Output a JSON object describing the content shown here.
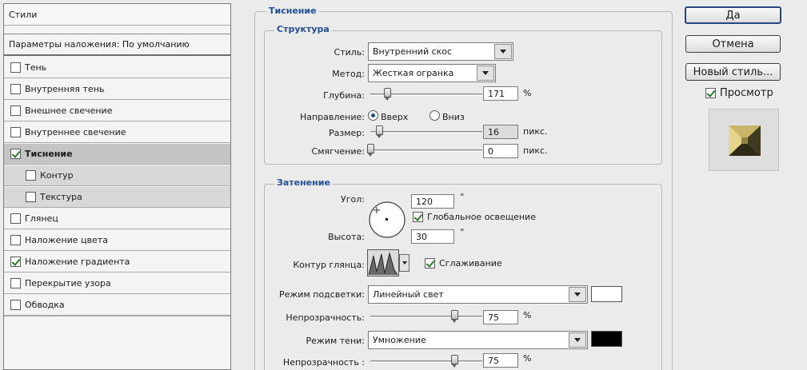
{
  "styles_panel": {
    "header": "Стили",
    "blending_options": "Параметры наложения: По умолчанию",
    "items": [
      {
        "label": "Тень",
        "checked": false
      },
      {
        "label": "Внутренняя тень",
        "checked": false
      },
      {
        "label": "Внешнее свечение",
        "checked": false
      },
      {
        "label": "Внутреннее свечение",
        "checked": false
      },
      {
        "label": "Тиснение",
        "checked": true
      },
      {
        "label": "Контур",
        "checked": false
      },
      {
        "label": "Текстура",
        "checked": false
      },
      {
        "label": "Глянец",
        "checked": false
      },
      {
        "label": "Наложение цвета",
        "checked": false
      },
      {
        "label": "Наложение градиента",
        "checked": true
      },
      {
        "label": "Перекрытие узора",
        "checked": false
      },
      {
        "label": "Обводка",
        "checked": false
      }
    ]
  },
  "bevel": {
    "group_title": "Тиснение",
    "structure": {
      "title": "Структура",
      "style_label": "Стиль:",
      "style_value": "Внутренний скос",
      "technique_label": "Метод:",
      "technique_value": "Жесткая огранка",
      "depth_label": "Глубина:",
      "depth_value": "171",
      "depth_unit": "%",
      "depth_level": 0.15,
      "direction_label": "Направление:",
      "direction_up": "Вверх",
      "direction_down": "Вниз",
      "size_label": "Размер:",
      "size_value": "16",
      "size_unit": "пикс.",
      "size_level": 0.08,
      "soften_label": "Смягчение:",
      "soften_value": "0",
      "soften_unit": "пикс.",
      "soften_level": 0.0
    },
    "shading": {
      "title": "Затенение",
      "angle_label": "Угол:",
      "angle_value": "120",
      "angle_unit": "°",
      "global_light_label": "Глобальное освещение",
      "altitude_label": "Высота:",
      "altitude_value": "30",
      "altitude_unit": "°",
      "gloss_contour_label": "Контур глянца:",
      "antialias_label": "Сглаживание",
      "highlight_mode_label": "Режим подсветки:",
      "highlight_mode_value": "Линейный свет",
      "highlight_color": "#ffffff",
      "highlight_opacity_label": "Непрозрачность:",
      "highlight_opacity_value": "75",
      "highlight_opacity_unit": "%",
      "highlight_opacity_level": 0.75,
      "shadow_mode_label": "Режим тени:",
      "shadow_mode_value": "Умножение",
      "shadow_color": "#000000",
      "shadow_opacity_label": "Непрозрачность :",
      "shadow_opacity_value": "75",
      "shadow_opacity_unit": "%",
      "shadow_opacity_level": 0.75
    }
  },
  "buttons": {
    "ok": "Да",
    "cancel": "Отмена",
    "new_style": "Новый стиль...",
    "preview": "Просмотр"
  },
  "icons": {
    "dropdown": "chevron-down-icon",
    "checkbox": "checkmark-icon",
    "angle_dial": "angle-dial-icon",
    "gloss_contour": "contour-curve-icon",
    "preview": "bevel-preview-icon"
  }
}
